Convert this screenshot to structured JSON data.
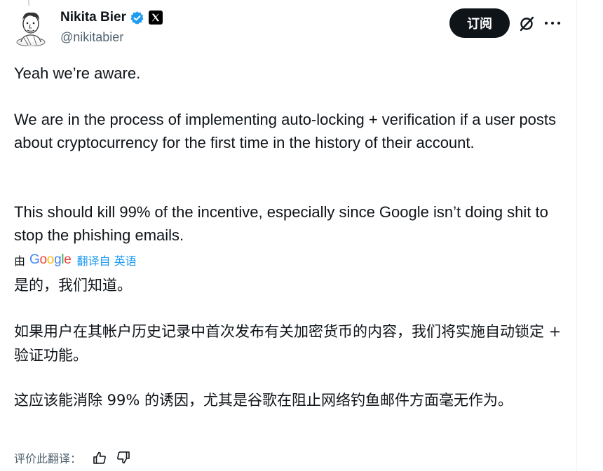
{
  "author": {
    "name": "Nikita Bier",
    "handle": "@nikitabier",
    "verified": true,
    "affiliate_badge": "x-logo-icon"
  },
  "actions": {
    "subscribe_label": "订阅",
    "grok_icon": "grok-icon",
    "more_icon": "more-icon"
  },
  "tweet": {
    "paragraphs": [
      "Yeah we’re aware.",
      "We are in the process of implementing auto-locking + verification if a user posts about cryptocurrency for the first time in the history of their account.",
      "This should kill 99% of the incentive, especially since Google isn’t doing shit to stop the phishing emails."
    ]
  },
  "translation": {
    "by_prefix": "由",
    "provider": "Google",
    "from_text": "翻译自 英语",
    "paragraphs": [
      "是的，我们知道。",
      "如果用户在其帐户历史记录中首次发布有关加密货币的内容，我们将实施自动锁定 + 验证功能。",
      "这应该能消除 99% 的诱因，尤其是谷歌在阻止网络钓鱼邮件方面毫无作为。"
    ],
    "rate_label": "评价此翻译："
  },
  "colors": {
    "text": "#0f1419",
    "secondary": "#536471",
    "accent": "#1d9bf0",
    "button_bg": "#0f1419"
  }
}
